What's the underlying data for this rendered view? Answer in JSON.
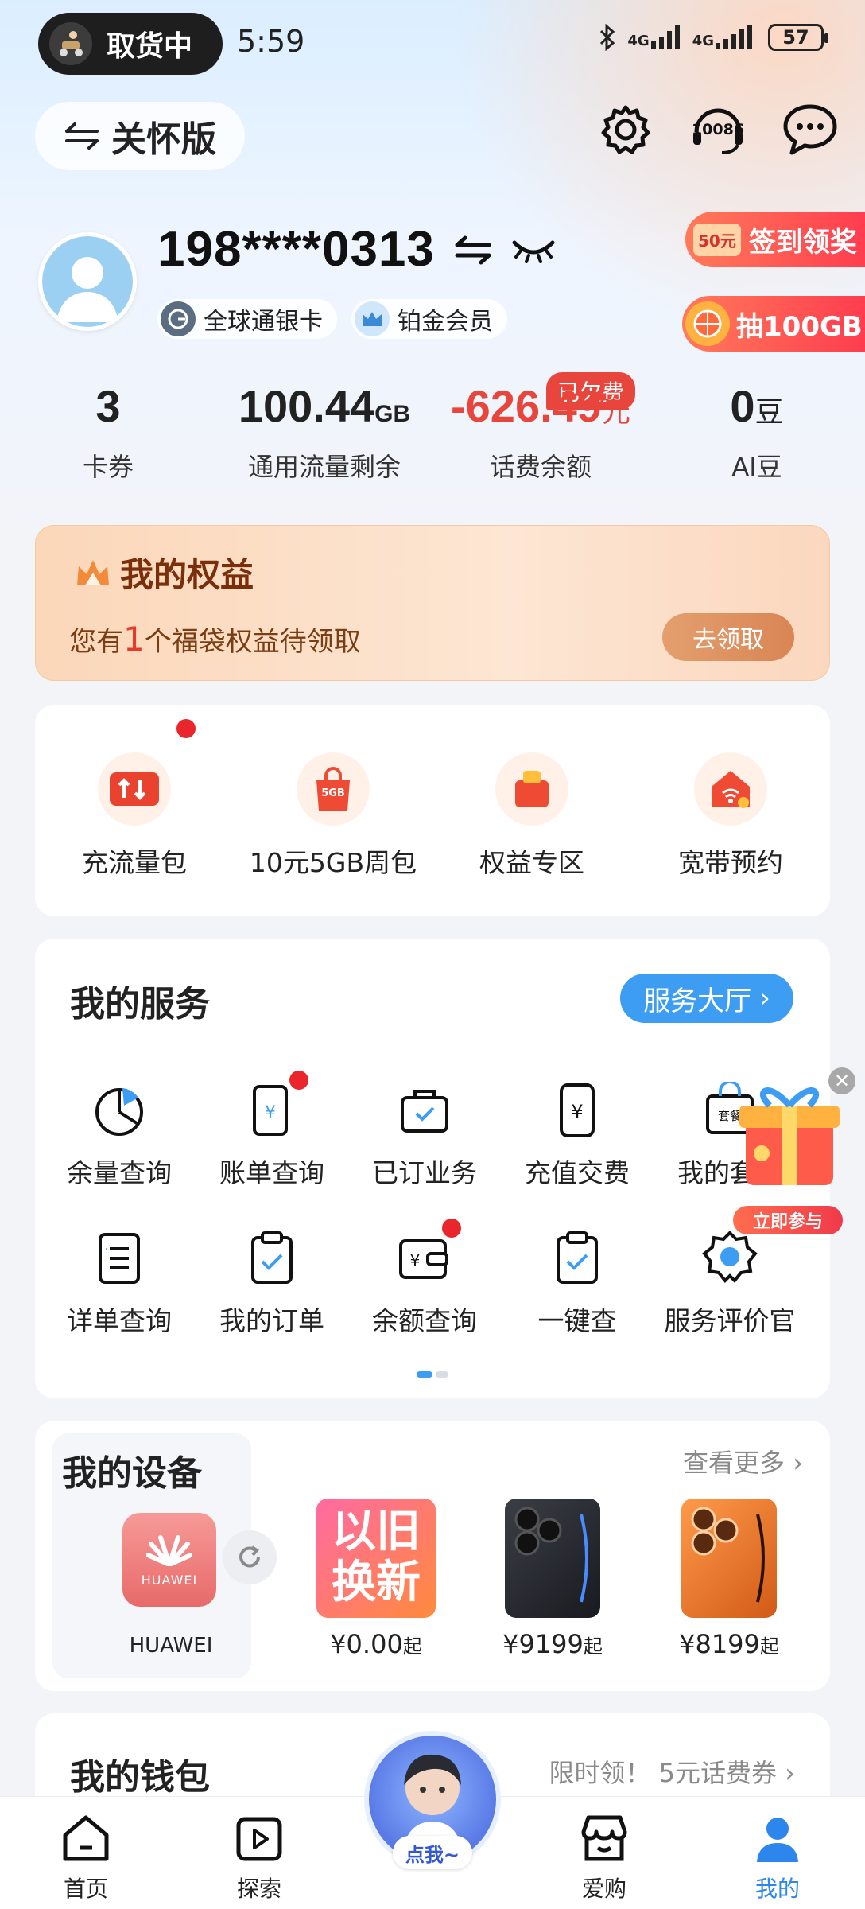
{
  "status_bar": {
    "activity": "取货中",
    "time": "5:59",
    "net1": "4G",
    "net2": "4G",
    "battery": "57"
  },
  "header": {
    "care_mode": "关怀版",
    "hotline": "10086"
  },
  "profile": {
    "phone": "198****0313",
    "badges": [
      "全球通银卡",
      "铂金会员"
    ],
    "promo_signin_amount": "50元",
    "promo_signin": "签到领奖",
    "promo_lottery": "抽100GB"
  },
  "stats": [
    {
      "value": "3",
      "unit": "",
      "label": "卡券"
    },
    {
      "value": "100.44",
      "unit": "GB",
      "label": "通用流量剩余"
    },
    {
      "value": "-626.49",
      "unit": "元",
      "label": "话费余额",
      "tag": "已欠费"
    },
    {
      "value": "0",
      "unit": "豆",
      "label": "AI豆"
    }
  ],
  "benefit": {
    "title": "我的权益",
    "sub_pre": "您有",
    "count": "1",
    "sub_post": "个福袋权益待领取",
    "button": "去领取"
  },
  "quick": [
    {
      "label": "充流量包",
      "icon": "traffic-pack-icon"
    },
    {
      "label": "10元5GB周包",
      "icon": "5gb-bag-icon",
      "badge": "5GB"
    },
    {
      "label": "权益专区",
      "icon": "gift-bag-icon"
    },
    {
      "label": "宽带预约",
      "icon": "broadband-home-icon"
    }
  ],
  "services": {
    "title": "我的服务",
    "hall": "服务大厅",
    "items": [
      {
        "label": "余量查询"
      },
      {
        "label": "账单查询"
      },
      {
        "label": "已订业务"
      },
      {
        "label": "充值交费"
      },
      {
        "label": "我的套餐"
      },
      {
        "label": "详单查询"
      },
      {
        "label": "我的订单"
      },
      {
        "label": "余额查询"
      },
      {
        "label": "一键查"
      },
      {
        "label": "服务评价官"
      }
    ],
    "package_icon_text": "套餐",
    "float_join": "立即参与"
  },
  "devices": {
    "title": "我的设备",
    "more": "查看更多",
    "device_name": "HUAWEI",
    "products": [
      {
        "img_text_1": "以旧",
        "img_text_2": "换新",
        "price": "¥0.00",
        "suffix": "起"
      },
      {
        "price": "¥9199",
        "suffix": "起"
      },
      {
        "price": "¥8199",
        "suffix": "起"
      }
    ]
  },
  "wallet": {
    "title": "我的钱包",
    "promo": "限时领！ 5元话费券"
  },
  "nav": {
    "home": "首页",
    "explore": "探索",
    "assistant": "点我~",
    "shop": "爱购",
    "mine": "我的"
  },
  "colors": {
    "accent_blue": "#3d9df3",
    "alert_red": "#e8453c",
    "benefit_brown": "#7a2e0a"
  }
}
